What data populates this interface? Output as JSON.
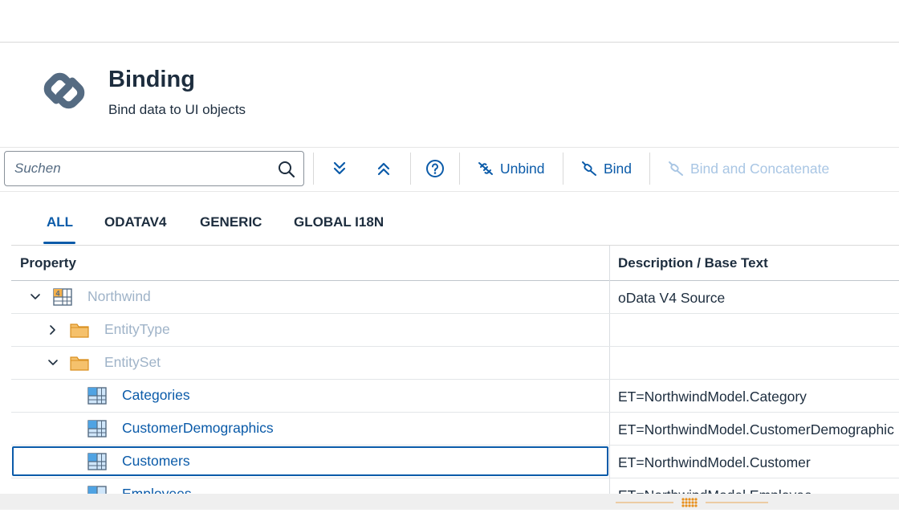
{
  "header": {
    "title": "Binding",
    "subtitle": "Bind data to UI objects",
    "logo_icon": "chain-link-icon"
  },
  "toolbar": {
    "search_placeholder": "Suchen",
    "expand_all_icon": "expand-all-icon",
    "collapse_all_icon": "collapse-all-icon",
    "help_icon": "help-icon",
    "unbind_label": "Unbind",
    "bind_label": "Bind",
    "bind_concat_label": "Bind and Concatenate"
  },
  "tabs": {
    "all": "ALL",
    "odatav4": "ODATAV4",
    "generic": "GENERIC",
    "global": "GLOBAL I18N",
    "active": "ALL"
  },
  "table": {
    "col_property": "Property",
    "col_description": "Description / Base Text",
    "rows": [
      {
        "label": "Northwind",
        "desc": "oData V4 Source"
      },
      {
        "label": "EntityType",
        "desc": ""
      },
      {
        "label": "EntitySet",
        "desc": ""
      },
      {
        "label": "Categories",
        "desc": "ET=NorthwindModel.Category"
      },
      {
        "label": "CustomerDemographics",
        "desc": "ET=NorthwindModel.CustomerDemographic"
      },
      {
        "label": "Customers",
        "desc": "ET=NorthwindModel.Customer"
      },
      {
        "label": "Employees",
        "desc": "ET=NorthwindModel.Employee"
      }
    ]
  },
  "colors": {
    "accent": "#0b5ba9",
    "disabled": "#a9c6e4",
    "folder": "#f5b04a"
  }
}
